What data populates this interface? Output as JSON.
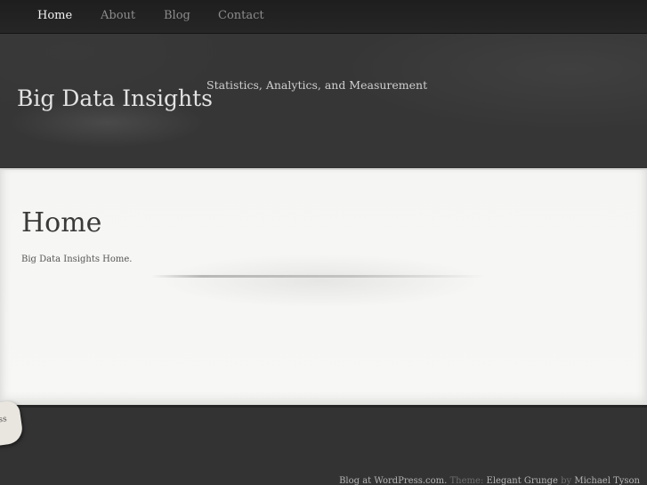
{
  "nav": {
    "items": [
      {
        "label": "Home"
      },
      {
        "label": "About"
      },
      {
        "label": "Blog"
      },
      {
        "label": "Contact"
      }
    ]
  },
  "header": {
    "site_title": "Big Data Insights",
    "tagline": "Statistics, Analytics, and Measurement"
  },
  "main": {
    "heading": "Home",
    "body": "Big Data Insights Home."
  },
  "scrap": {
    "text": "ss"
  },
  "footer": {
    "blog_link": "Blog at WordPress.com.",
    "theme_prefix": "Theme:",
    "theme_name": "Elegant Grunge",
    "by_text": "by",
    "author": "Michael Tyson"
  },
  "colors": {
    "nav_bg": "#1e1e1e",
    "header_bg": "#363636",
    "content_bg": "#f5f5f3",
    "title_text": "#e2e2e2",
    "active_nav": "#f2f2f2",
    "inactive_nav": "#8c8c8c"
  }
}
